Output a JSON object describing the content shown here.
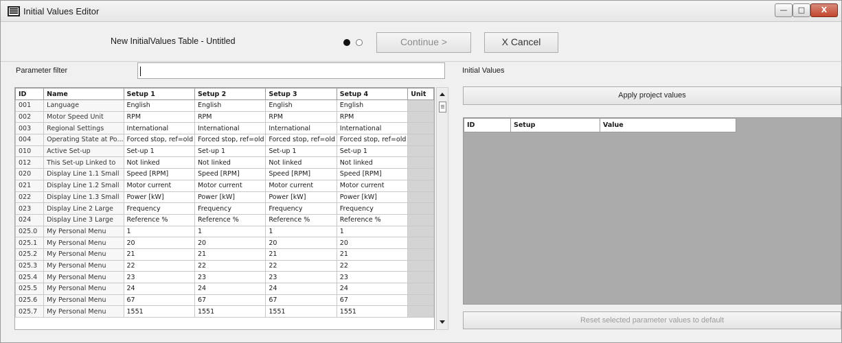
{
  "window": {
    "title": "Initial Values Editor",
    "controls": {
      "minimize": "—",
      "maximize": "□",
      "close": "X"
    }
  },
  "wizard": {
    "table_title": "New InitialValues Table - Untitled",
    "continue_label": "Continue >",
    "cancel_label": "X Cancel",
    "step_current": 1,
    "step_total": 2
  },
  "filter": {
    "label": "Parameter filter",
    "value": ""
  },
  "params": {
    "columns": [
      "ID",
      "Name",
      "Setup 1",
      "Setup 2",
      "Setup 3",
      "Setup 4",
      "Unit"
    ],
    "rows": [
      {
        "id": "001",
        "name": "Language",
        "s1": "English",
        "s2": "English",
        "s3": "English",
        "s4": "English",
        "unit": ""
      },
      {
        "id": "002",
        "name": "Motor Speed Unit",
        "s1": "RPM",
        "s2": "RPM",
        "s3": "RPM",
        "s4": "RPM",
        "unit": ""
      },
      {
        "id": "003",
        "name": "Regional Settings",
        "s1": "International",
        "s2": "International",
        "s3": "International",
        "s4": "International",
        "unit": ""
      },
      {
        "id": "004",
        "name": "Operating State at Po...",
        "s1": "Forced stop, ref=old",
        "s2": "Forced stop, ref=old",
        "s3": "Forced stop, ref=old",
        "s4": "Forced stop, ref=old",
        "unit": ""
      },
      {
        "id": "010",
        "name": "Active Set-up",
        "s1": "Set-up 1",
        "s2": "Set-up 1",
        "s3": "Set-up 1",
        "s4": "Set-up 1",
        "unit": ""
      },
      {
        "id": "012",
        "name": "This Set-up Linked to",
        "s1": "Not linked",
        "s2": "Not linked",
        "s3": "Not linked",
        "s4": "Not linked",
        "unit": ""
      },
      {
        "id": "020",
        "name": "Display Line 1.1 Small",
        "s1": "Speed [RPM]",
        "s2": "Speed [RPM]",
        "s3": "Speed [RPM]",
        "s4": "Speed [RPM]",
        "unit": ""
      },
      {
        "id": "021",
        "name": "Display Line 1.2 Small",
        "s1": "Motor current",
        "s2": "Motor current",
        "s3": "Motor current",
        "s4": "Motor current",
        "unit": ""
      },
      {
        "id": "022",
        "name": "Display Line 1.3 Small",
        "s1": "Power [kW]",
        "s2": "Power [kW]",
        "s3": "Power [kW]",
        "s4": "Power [kW]",
        "unit": ""
      },
      {
        "id": "023",
        "name": "Display Line 2 Large",
        "s1": "Frequency",
        "s2": "Frequency",
        "s3": "Frequency",
        "s4": "Frequency",
        "unit": ""
      },
      {
        "id": "024",
        "name": "Display Line 3 Large",
        "s1": "Reference %",
        "s2": "Reference %",
        "s3": "Reference %",
        "s4": "Reference %",
        "unit": ""
      },
      {
        "id": "025.0",
        "name": "My Personal Menu",
        "s1": "1",
        "s2": "1",
        "s3": "1",
        "s4": "1",
        "unit": ""
      },
      {
        "id": "025.1",
        "name": "My Personal Menu",
        "s1": "20",
        "s2": "20",
        "s3": "20",
        "s4": "20",
        "unit": ""
      },
      {
        "id": "025.2",
        "name": "My Personal Menu",
        "s1": "21",
        "s2": "21",
        "s3": "21",
        "s4": "21",
        "unit": ""
      },
      {
        "id": "025.3",
        "name": "My Personal Menu",
        "s1": "22",
        "s2": "22",
        "s3": "22",
        "s4": "22",
        "unit": ""
      },
      {
        "id": "025.4",
        "name": "My Personal Menu",
        "s1": "23",
        "s2": "23",
        "s3": "23",
        "s4": "23",
        "unit": ""
      },
      {
        "id": "025.5",
        "name": "My Personal Menu",
        "s1": "24",
        "s2": "24",
        "s3": "24",
        "s4": "24",
        "unit": ""
      },
      {
        "id": "025.6",
        "name": "My Personal Menu",
        "s1": "67",
        "s2": "67",
        "s3": "67",
        "s4": "67",
        "unit": ""
      },
      {
        "id": "025.7",
        "name": "My Personal Menu",
        "s1": "1551",
        "s2": "1551",
        "s3": "1551",
        "s4": "1551",
        "unit": ""
      }
    ]
  },
  "initial_values": {
    "label": "Initial Values",
    "apply_label": "Apply project values",
    "columns": [
      "ID",
      "Setup",
      "Value"
    ],
    "reset_label": "Reset selected parameter values to default"
  }
}
